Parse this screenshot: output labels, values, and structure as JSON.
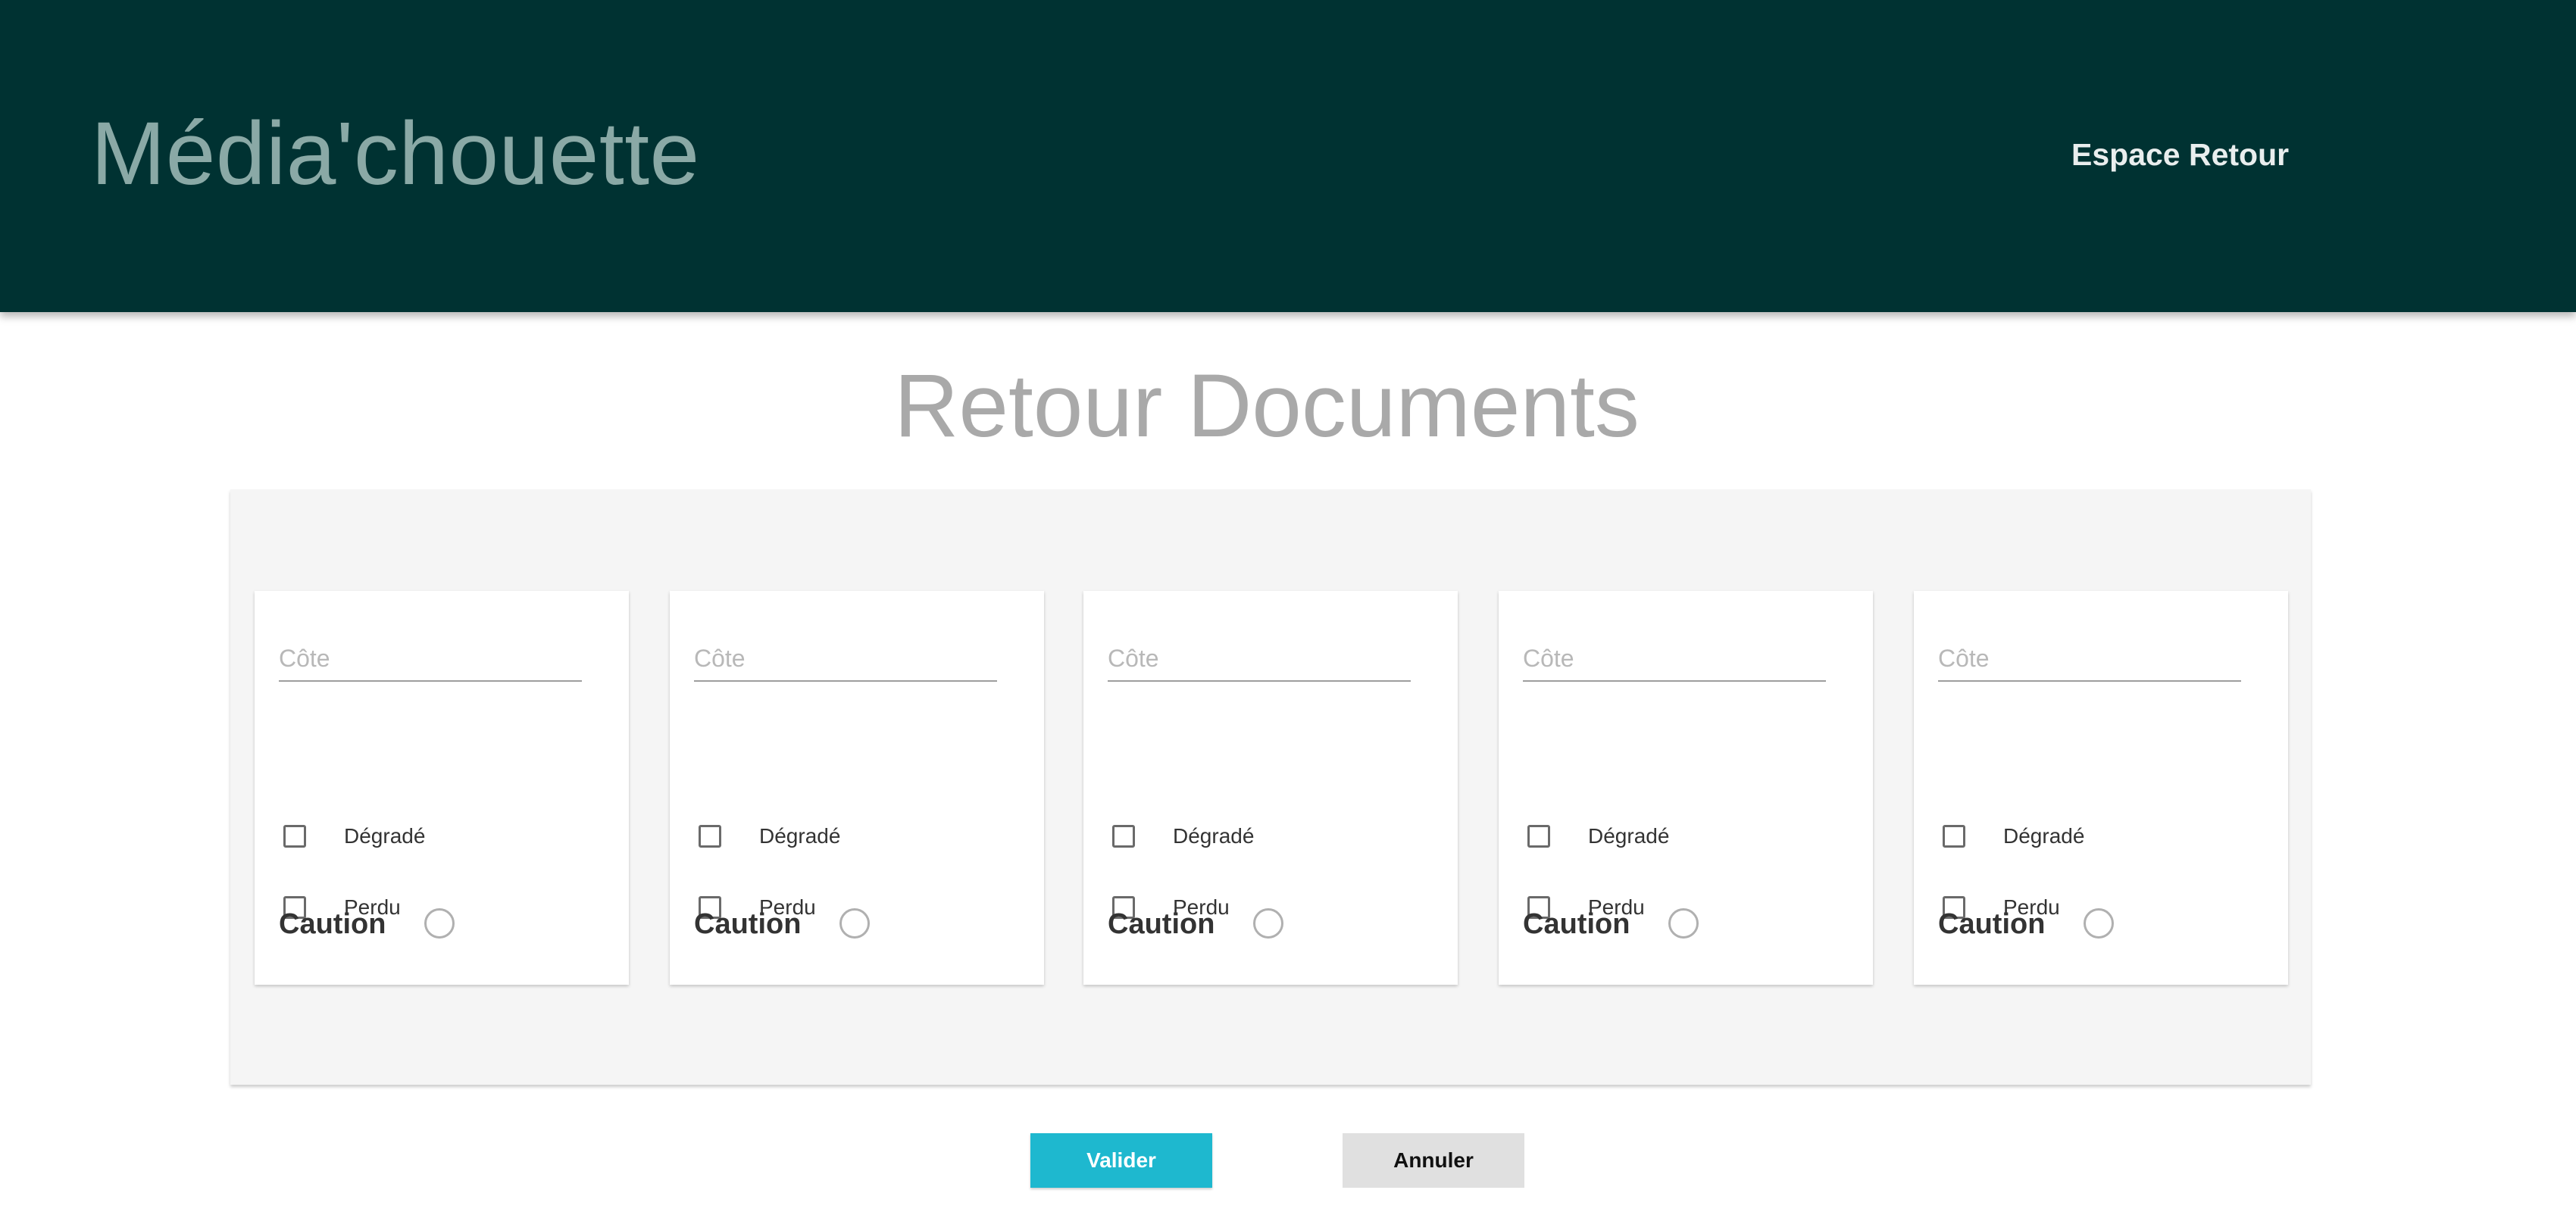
{
  "header": {
    "brand": "Média'chouette",
    "nav_link": "Espace Retour",
    "background_color": "#003232"
  },
  "main": {
    "title": "Retour Documents",
    "cards": [
      {
        "cote_placeholder": "Côte",
        "cote_value": "",
        "degrade_label": "Dégradé",
        "perdu_label": "Perdu",
        "caution_label": "Caution"
      },
      {
        "cote_placeholder": "Côte",
        "cote_value": "",
        "degrade_label": "Dégradé",
        "perdu_label": "Perdu",
        "caution_label": "Caution"
      },
      {
        "cote_placeholder": "Côte",
        "cote_value": "",
        "degrade_label": "Dégradé",
        "perdu_label": "Perdu",
        "caution_label": "Caution"
      },
      {
        "cote_placeholder": "Côte",
        "cote_value": "",
        "degrade_label": "Dégradé",
        "perdu_label": "Perdu",
        "caution_label": "Caution"
      },
      {
        "cote_placeholder": "Côte",
        "cote_value": "",
        "degrade_label": "Dégradé",
        "perdu_label": "Perdu",
        "caution_label": "Caution"
      }
    ]
  },
  "actions": {
    "validate_label": "Valider",
    "cancel_label": "Annuler",
    "validate_color": "#1eb8cf",
    "cancel_color": "#e0e0e0"
  }
}
